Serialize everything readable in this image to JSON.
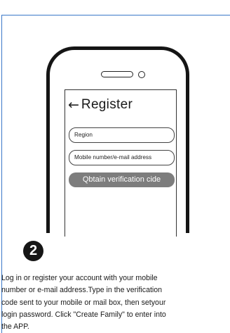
{
  "screen": {
    "title": "Register",
    "region_placeholder": "Region",
    "mobile_placeholder": "Mobile number/e-mail address",
    "verify_button_label": "Qbtain verification cide"
  },
  "step": {
    "number": "2"
  },
  "description": {
    "lines": [
      "Log in or register your account with your mobile",
      "number or e-mail address.Type in the verification",
      "code sent to your mobile or mail box, then setyour",
      "login password. Click \"Create Family\" to enter into",
      "the APP."
    ]
  },
  "icons": {
    "back": "arrow-left-icon"
  },
  "colors": {
    "frame": "#3a78c8",
    "button": "#7d7d7d",
    "outline": "#151515"
  }
}
